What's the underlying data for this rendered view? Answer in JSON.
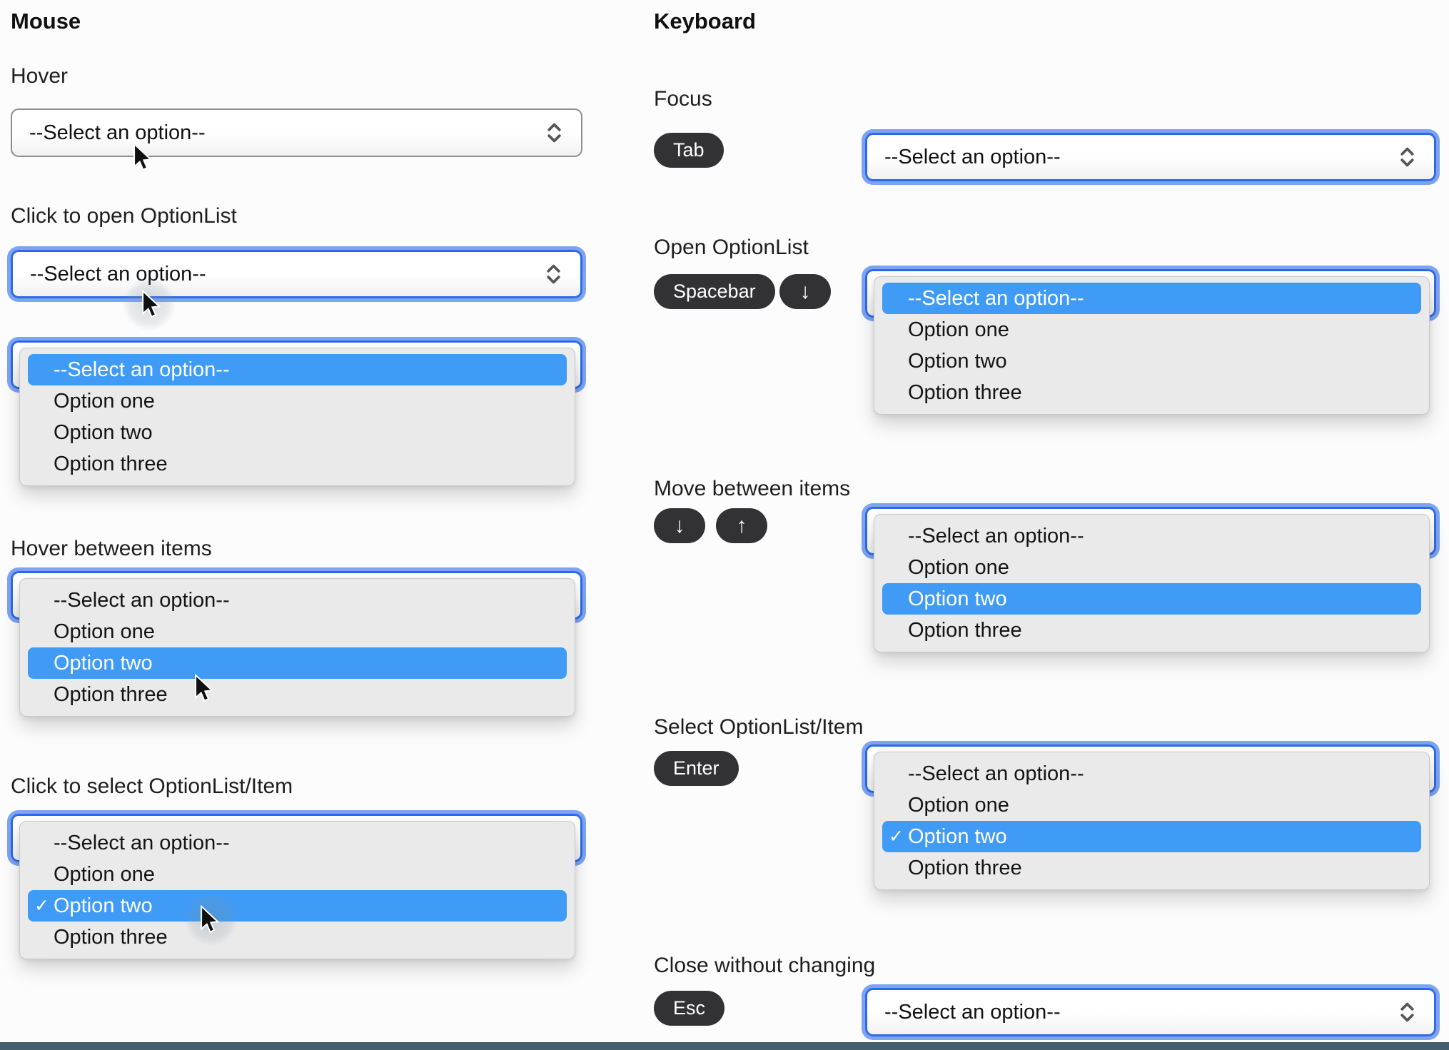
{
  "page": {
    "bottom_bar_color": "#44606e"
  },
  "options": [
    "--Select an option--",
    "Option one",
    "Option two",
    "Option three"
  ],
  "glyphs": {
    "checkmark": "✓"
  },
  "mouse": {
    "title": "Mouse",
    "hover": {
      "label": "Hover",
      "value": "--Select an option--"
    },
    "click_open": {
      "label": "Click to open OptionList",
      "value": "--Select an option--",
      "highlighted_option": "--Select an option--"
    },
    "hover_items": {
      "label": "Hover between items",
      "highlighted_option": "Option two"
    },
    "click_select": {
      "label": "Click to select OptionList/Item",
      "highlighted_option": "Option two",
      "selected_option": "Option two"
    }
  },
  "keyboard": {
    "title": "Keyboard",
    "focus": {
      "label": "Focus",
      "key": "Tab",
      "value": "--Select an option--"
    },
    "open_list": {
      "label": "Open OptionList",
      "keys": [
        "Spacebar",
        "↓"
      ],
      "highlighted_option": "--Select an option--"
    },
    "move": {
      "label": "Move between items",
      "keys": [
        "↓",
        "↑"
      ],
      "highlighted_option": "Option two"
    },
    "select_item": {
      "label": "Select OptionList/Item",
      "key": "Enter",
      "highlighted_option": "Option two",
      "selected_option": "Option two"
    },
    "close": {
      "label": "Close without changing",
      "key": "Esc",
      "value": "--Select an option--"
    }
  }
}
